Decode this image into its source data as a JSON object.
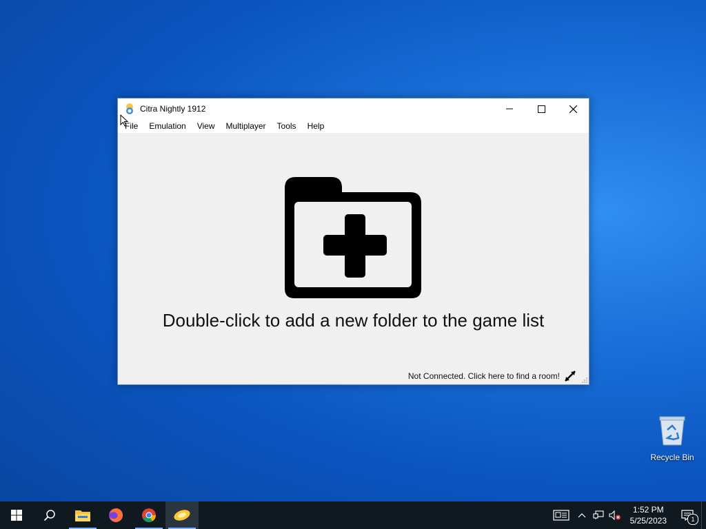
{
  "window": {
    "title": "Citra Nightly 1912",
    "menu": [
      "File",
      "Emulation",
      "View",
      "Multiplayer",
      "Tools",
      "Help"
    ],
    "hint": "Double-click to add a new folder to the game list",
    "status": "Not Connected. Click here to find a room!"
  },
  "desktop": {
    "recycle_bin_label": "Recycle Bin"
  },
  "taskbar": {
    "time": "1:52 PM",
    "date": "5/25/2023",
    "notification_count": "1"
  }
}
